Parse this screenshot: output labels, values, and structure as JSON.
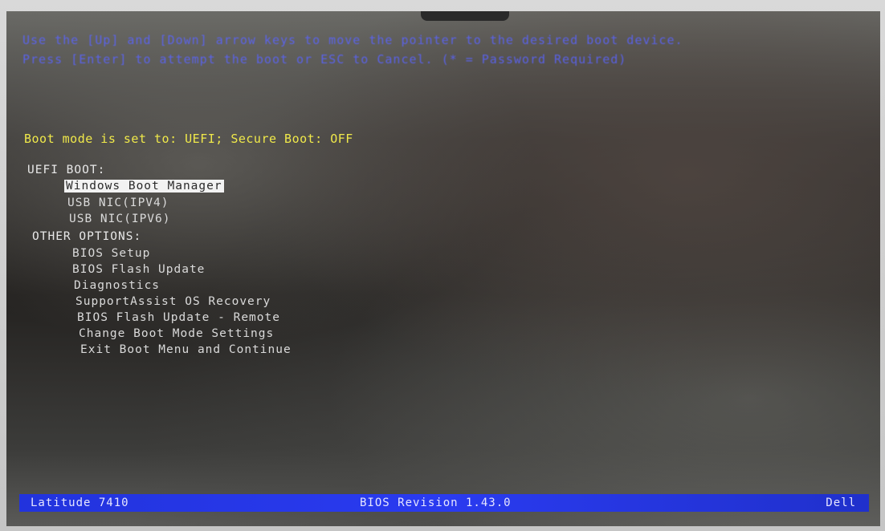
{
  "instructions": {
    "line1": "Use the [Up] and [Down] arrow keys to move the pointer to the desired boot device.",
    "line2": "Press [Enter] to attempt the boot or ESC to Cancel. (* = Password Required)"
  },
  "boot_mode_text": "Boot mode is set to: UEFI; Secure Boot: OFF",
  "uefi_boot": {
    "header": "UEFI BOOT:",
    "items": [
      "Windows Boot Manager",
      "USB NIC(IPV4)",
      "USB NIC(IPV6)"
    ],
    "selected_index": 0
  },
  "other_options": {
    "header": "OTHER OPTIONS:",
    "items": [
      "BIOS Setup",
      "BIOS Flash Update",
      "Diagnostics",
      "SupportAssist OS Recovery",
      "BIOS Flash Update - Remote",
      "Change Boot Mode Settings",
      "Exit Boot Menu and Continue"
    ]
  },
  "footer": {
    "model": "Latitude 7410",
    "bios_revision": "BIOS Revision 1.43.0",
    "vendor": "Dell"
  },
  "colors": {
    "instruction_text": "#5a64ff",
    "boot_mode_text": "#f0e94a",
    "menu_text": "#dadada",
    "selection_bg": "#f2f2f2",
    "footer_bar": "#2a3bf0"
  }
}
